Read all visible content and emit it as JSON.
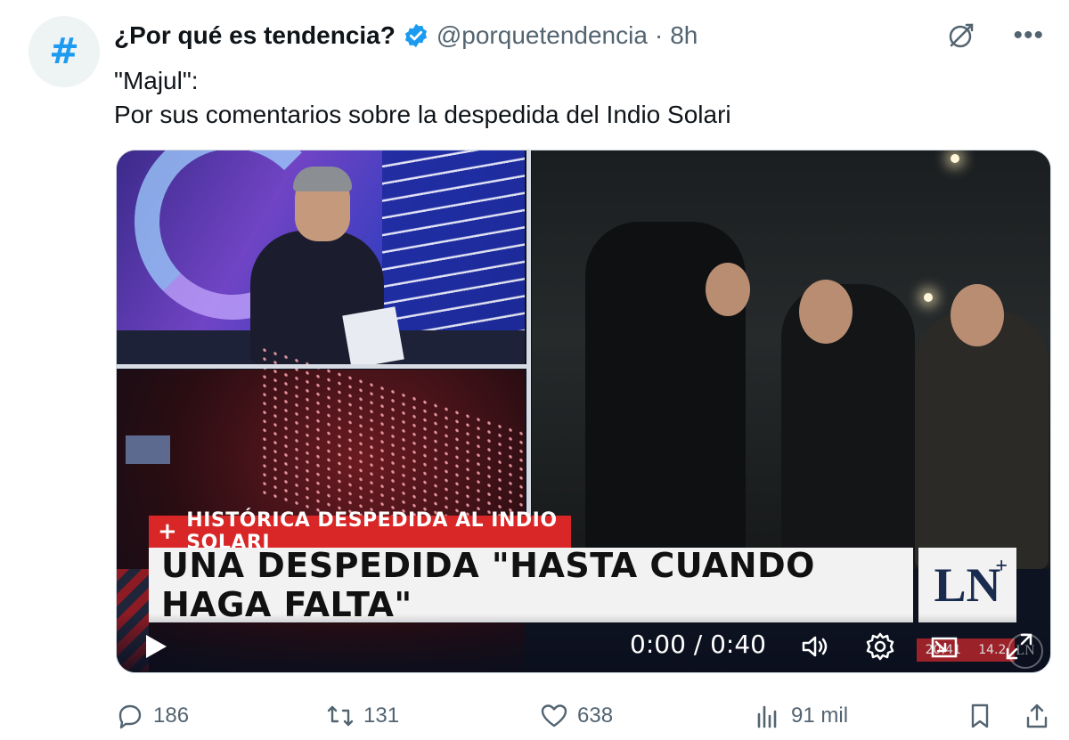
{
  "author": {
    "avatar_symbol": "#",
    "display_name": "¿Por qué es tendencia?",
    "handle": "@porquetendencia",
    "separator": "·",
    "time": "8h",
    "verified": true
  },
  "tweet": {
    "line1": "\"Majul\":",
    "line2": "Por sus comentarios sobre la despedida del Indio Solari"
  },
  "video": {
    "lower_third_tag": "HISTÓRICA DESPEDIDA AL INDIO SOLARI",
    "lower_third_headline": "UNA DESPEDIDA \"HASTA CUANDO HAGA FALTA\"",
    "channel_logo": "LN",
    "channel_logo_plus": "+",
    "time_display": "0:00 / 0:40",
    "badge_left": "20:41",
    "badge_right": "14.2",
    "watermark": "LN"
  },
  "actions": {
    "replies": "186",
    "reposts": "131",
    "likes": "638",
    "views": "91 mil"
  },
  "colors": {
    "accent": "#1d9bf0",
    "text": "#0f1419",
    "muted": "#536471",
    "news_red": "#d92626"
  }
}
